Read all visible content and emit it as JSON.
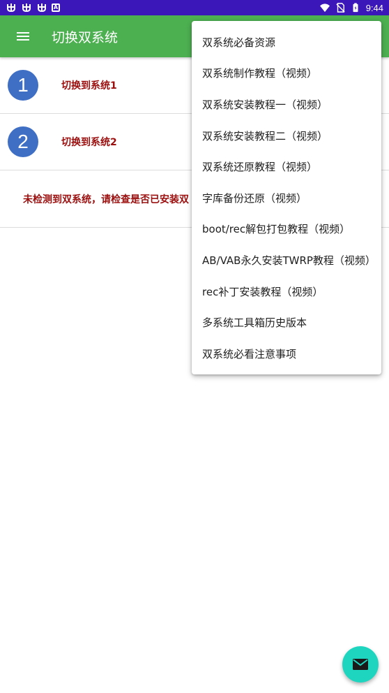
{
  "status_bar": {
    "time": "9:44",
    "icons_left": [
      "bug-icon",
      "bug-icon",
      "bug-icon",
      "a-icon"
    ],
    "icons_right": [
      "wifi-icon",
      "no-sim-icon",
      "battery-icon"
    ]
  },
  "app_bar": {
    "title": "切换双系统",
    "color": "#4caf50",
    "menu_icon": "hamburger-menu-icon"
  },
  "list": {
    "items": [
      {
        "number": "1",
        "label": "切换到系统1"
      },
      {
        "number": "2",
        "label": "切换到系统2"
      }
    ],
    "warning": "未检测到双系统，请检查是否已安装双",
    "accent_text_color": "#9b0f0f",
    "circle_color": "#3f6fc5"
  },
  "menu": {
    "items": [
      "双系统必备资源",
      "双系统制作教程（视频）",
      "双系统安装教程一（视频）",
      "双系统安装教程二（视频）",
      "双系统还原教程（视频）",
      "字库备份还原（视频）",
      "boot/rec解包打包教程（视频）",
      "AB/VAB永久安装TWRP教程（视频）",
      "rec补丁安装教程（视频）",
      "多系统工具箱历史版本",
      "双系统必看注意事项"
    ]
  },
  "fab": {
    "icon": "mail-icon",
    "color": "#1ed6c0"
  }
}
